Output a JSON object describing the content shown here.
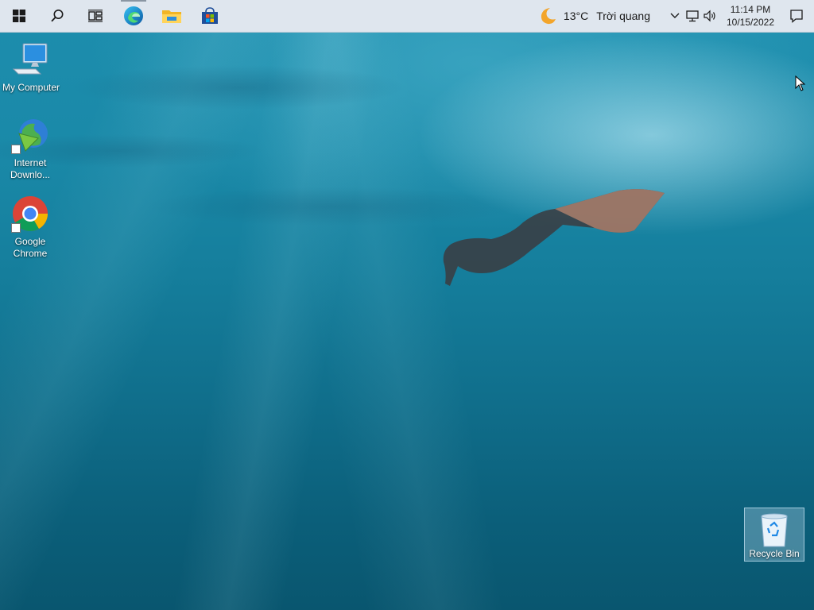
{
  "taskbar": {
    "start_icon": "windows-logo-icon",
    "search_icon": "search-icon",
    "widgets_icon": "widgets-icon",
    "pinned": [
      {
        "name": "edge-icon"
      },
      {
        "name": "file-explorer-icon"
      },
      {
        "name": "microsoft-store-icon"
      }
    ]
  },
  "tray": {
    "weather_icon": "moon-icon",
    "temperature": "13°C",
    "condition": "Trời quang",
    "time": "11:14 PM",
    "date": "10/15/2022"
  },
  "desktop": {
    "icons": [
      {
        "label": "My Computer"
      },
      {
        "label": "Internet Downlo..."
      },
      {
        "label": "Google Chrome"
      }
    ],
    "recycle_bin": {
      "label": "Recycle Bin"
    }
  }
}
